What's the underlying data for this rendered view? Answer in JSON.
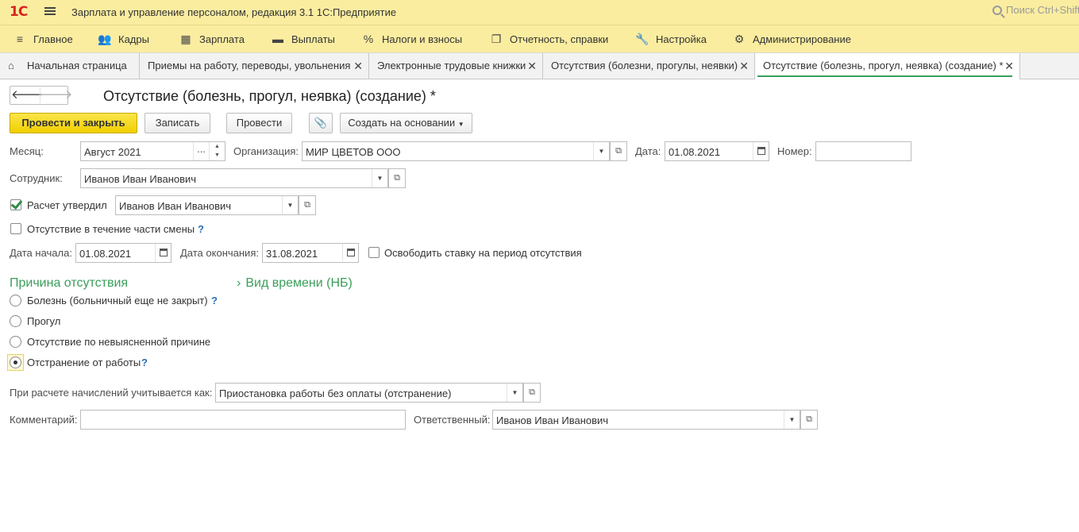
{
  "app": {
    "logo_text": "1С",
    "title": "Зарплата и управление персоналом, редакция 3.1 1С:Предприятие",
    "search_placeholder": "Поиск Ctrl+Shift+F"
  },
  "menu": [
    {
      "label": "Главное",
      "icon": "hamburger-icon"
    },
    {
      "label": "Кадры",
      "icon": "people-icon"
    },
    {
      "label": "Зарплата",
      "icon": "calculator-icon"
    },
    {
      "label": "Выплаты",
      "icon": "wallet-icon"
    },
    {
      "label": "Налоги и взносы",
      "icon": "percent-icon"
    },
    {
      "label": "Отчетность, справки",
      "icon": "documents-icon"
    },
    {
      "label": "Настройка",
      "icon": "wrench-icon"
    },
    {
      "label": "Администрирование",
      "icon": "gear-icon"
    }
  ],
  "tabs": [
    {
      "label": "Начальная страница"
    },
    {
      "label": "Приемы на работу, переводы, увольнения"
    },
    {
      "label": "Электронные трудовые книжки"
    },
    {
      "label": "Отсутствия (болезни, прогулы, неявки)"
    },
    {
      "label": "Отсутствие (болезнь, прогул, неявка) (создание) *"
    }
  ],
  "form": {
    "title": "Отсутствие (болезнь, прогул, неявка) (создание) *",
    "toolbar": {
      "post_close": "Провести и закрыть",
      "save": "Записать",
      "post": "Провести",
      "create_based": "Создать на основании"
    },
    "month_label": "Месяц:",
    "month_value": "Август 2021",
    "org_label": "Организация:",
    "org_value": "МИР ЦВЕТОВ ООО",
    "date_label": "Дата:",
    "date_value": "01.08.2021",
    "number_label": "Номер:",
    "number_value": "",
    "employee_label": "Сотрудник:",
    "employee_value": "Иванов Иван Иванович",
    "approved_label": "Расчет утвердил",
    "approved_checked": true,
    "approved_value": "Иванов Иван Иванович",
    "partial_shift_label": "Отсутствие в течение части смены",
    "partial_shift_checked": false,
    "help_mark": "?",
    "start_label": "Дата начала:",
    "start_value": "01.08.2021",
    "end_label": "Дата окончания:",
    "end_value": "31.08.2021",
    "free_rate_label": "Освободить ставку на период отсутствия",
    "free_rate_checked": false,
    "reason_section": "Причина отсутствия",
    "time_type_section": "Вид времени (НБ)",
    "reasons": [
      {
        "label": "Болезнь (больничный еще не закрыт)",
        "selected": false,
        "help": true
      },
      {
        "label": "Прогул",
        "selected": false,
        "help": false
      },
      {
        "label": "Отсутствие по невыясненной причине",
        "selected": false,
        "help": false
      },
      {
        "label": "Отстранение от работы",
        "selected": true,
        "help": true
      }
    ],
    "calc_label": "При расчете начислений учитывается как:",
    "calc_value": "Приостановка работы без оплаты (отстранение)",
    "comment_label": "Комментарий:",
    "comment_value": "",
    "responsible_label": "Ответственный:",
    "responsible_value": "Иванов Иван Иванович"
  }
}
